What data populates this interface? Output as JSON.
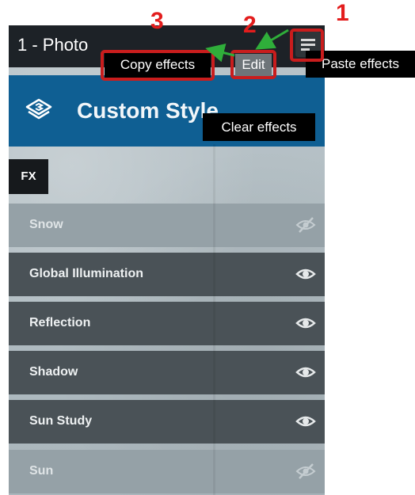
{
  "panel": {
    "title": "1 - Photo",
    "style_name": "Custom Style",
    "fx_label": "FX",
    "layers": [
      {
        "label": "Snow",
        "visible": false
      },
      {
        "label": "Global Illumination",
        "visible": true
      },
      {
        "label": "Reflection",
        "visible": true
      },
      {
        "label": "Shadow",
        "visible": true
      },
      {
        "label": "Sun Study",
        "visible": true
      },
      {
        "label": "Sun",
        "visible": false
      }
    ]
  },
  "menu": {
    "copy_effects": "Copy effects",
    "edit": "Edit",
    "paste_effects": "Paste effects",
    "clear_effects": "Clear effects"
  },
  "annotations": {
    "step1": "1",
    "step2": "2",
    "step3": "3",
    "color": "#e31d1d"
  },
  "colors": {
    "title_bar": "#1d2227",
    "style_header": "#0f5f93",
    "layer_visible": "#4a5257",
    "layer_hidden": "#95a1a7"
  }
}
